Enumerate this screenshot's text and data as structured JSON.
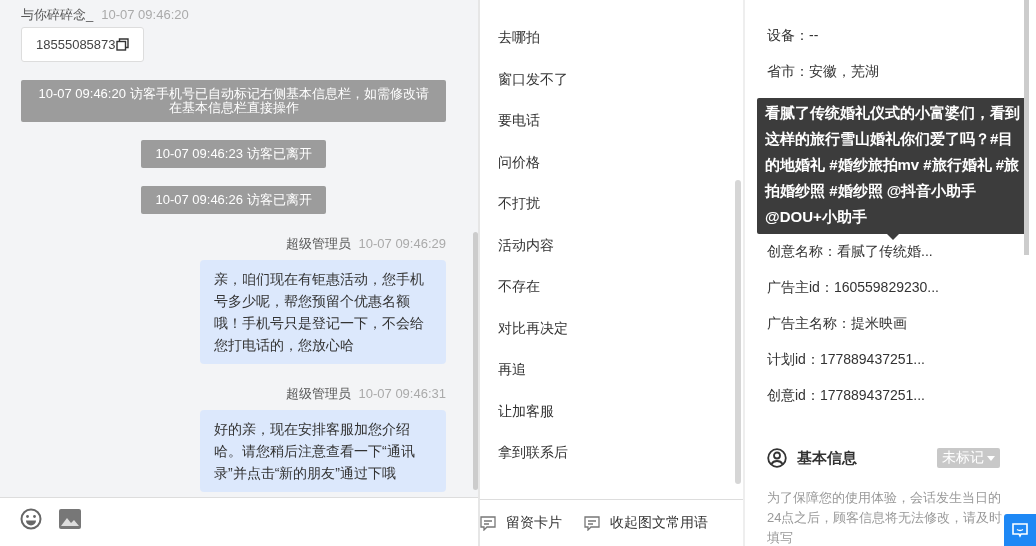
{
  "chat": {
    "messages": [
      {
        "kind": "visitor",
        "name": "与你碎碎念_",
        "time": "10-07 09:46:20",
        "text": "18555085873"
      },
      {
        "kind": "system",
        "text": "10-07 09:46:20 访客手机号已自动标记右侧基本信息栏，如需修改请在基本信息栏直接操作"
      },
      {
        "kind": "system",
        "text": "10-07 09:46:23 访客已离开"
      },
      {
        "kind": "system",
        "text": "10-07 09:46:26 访客已离开"
      },
      {
        "kind": "agent",
        "name": "超级管理员",
        "time": "10-07 09:46:29",
        "text": "亲，咱们现在有钜惠活动，您手机号多少呢，帮您预留个优惠名额哦！手机号只是登记一下，不会给您打电话的，您放心哈"
      },
      {
        "kind": "agent",
        "name": "超级管理员",
        "time": "10-07 09:46:31",
        "text": "好的亲，现在安排客服加您介绍哈。请您稍后注意查看一下“通讯录”并点击“新的朋友”通过下哦"
      }
    ]
  },
  "quick_replies": {
    "items": [
      "去哪拍",
      "窗口发不了",
      "要电话",
      "问价格",
      "不打扰",
      "活动内容",
      "不存在",
      "对比再决定",
      "再追",
      "让加客服",
      "拿到联系后"
    ],
    "buttons": [
      "留资卡片",
      "收起图文常用语"
    ]
  },
  "info": {
    "rows_top": [
      "设备：--",
      "省市：安徽，芜湖"
    ],
    "tooltip": "看腻了传统婚礼仪式的小富婆们，看到这样的旅行雪山婚礼你们爱了吗？#目的地婚礼 #婚纱旅拍mv #旅行婚礼 #旅拍婚纱照 #婚纱照 @抖音小助手 @DOU+小助手",
    "rows_bottom": [
      "创意名称：看腻了传统婚...",
      "广告主id：160559829230...",
      "广告主名称：提米映画",
      "计划id：177889437251...",
      "创意id：177889437251..."
    ],
    "basic": {
      "title": "基本信息",
      "tag": "未标记",
      "note": "为了保障您的使用体验，会话发生当日的24点之后，顾客信息将无法修改，请及时填写"
    }
  }
}
